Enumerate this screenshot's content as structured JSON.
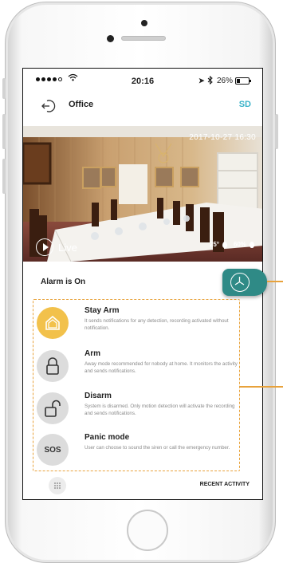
{
  "status_bar": {
    "time": "20:16",
    "battery": "26%",
    "battery_level": 0.26,
    "signal_dots_filled": 4,
    "signal_dots_total": 5
  },
  "header": {
    "title": "Office",
    "sd_label": "SD"
  },
  "camera": {
    "timestamp": "2017-10-27  16:30",
    "live_label": "Live",
    "temperature": "25°",
    "humidity": "60%"
  },
  "alarm": {
    "status": "Alarm is On",
    "modes": [
      {
        "title": "Stay Arm",
        "description": "It sends notifications for any detection, recording activated without notification.",
        "icon": "house-icon",
        "active": true
      },
      {
        "title": "Arm",
        "description": "Away mode recommended for nobody at home. It monitors the activity and sends notifications.",
        "icon": "padlock-closed-icon",
        "active": false
      },
      {
        "title": "Disarm",
        "description": "System is disarmed. Only motion detection will activate the recording and sends notifications.",
        "icon": "padlock-open-icon",
        "active": false
      },
      {
        "title": "Panic mode",
        "description": "User can choose to sound the siren or call the emergency number.",
        "icon": "sos-icon",
        "icon_text": "SOS",
        "active": false
      }
    ]
  },
  "bottom_bar": {
    "recent_activity": "RECENT ACTIVITY"
  },
  "colors": {
    "accent_teal": "#3bb3c9",
    "fab_teal": "#2f8a86",
    "active_mode_yellow": "#f2c14b",
    "callout_orange": "#e8a23b"
  }
}
